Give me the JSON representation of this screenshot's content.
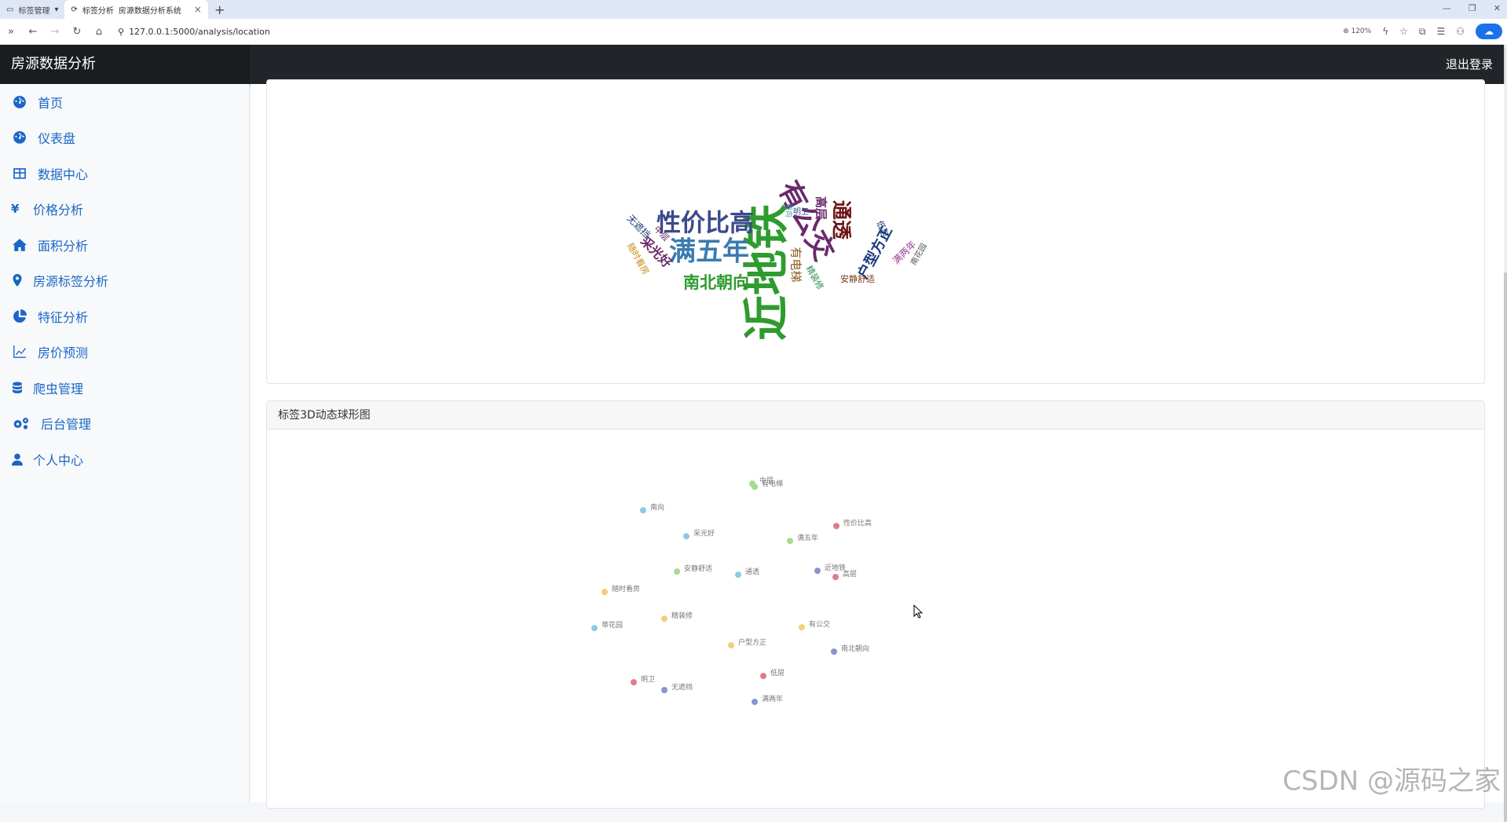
{
  "browser": {
    "tabs": [
      {
        "label": "标签管理",
        "kind": "group"
      },
      {
        "label": "标签分析",
        "kind": "normal"
      },
      {
        "label": "房源数据分析系统",
        "kind": "active"
      }
    ],
    "url": "127.0.0.1:5000/analysis/location",
    "zoom": "120%"
  },
  "header": {
    "brand": "房源数据分析",
    "logout": "退出登录"
  },
  "sidebar": {
    "items": [
      {
        "label": "首页",
        "icon": "dashboard-icon"
      },
      {
        "label": "仪表盘",
        "icon": "dashboard-icon"
      },
      {
        "label": "数据中心",
        "icon": "table-icon"
      },
      {
        "label": "价格分析",
        "icon": "yen-icon"
      },
      {
        "label": "面积分析",
        "icon": "home-icon"
      },
      {
        "label": "房源标签分析",
        "icon": "map-marker-icon"
      },
      {
        "label": "特征分析",
        "icon": "pie-chart-icon"
      },
      {
        "label": "房价预测",
        "icon": "line-chart-icon"
      },
      {
        "label": "爬虫管理",
        "icon": "database-icon"
      },
      {
        "label": "后台管理",
        "icon": "cogs-icon"
      },
      {
        "label": "个人中心",
        "icon": "user-icon"
      }
    ]
  },
  "sphere_card": {
    "title": "标签3D动态球形图"
  },
  "wordcloud": {
    "words": [
      {
        "text": "近地铁",
        "color": "#2e9b2e"
      },
      {
        "text": "满五年",
        "color": "#3a7bb0"
      },
      {
        "text": "性价比高",
        "color": "#3a4a8a"
      },
      {
        "text": "有公交",
        "color": "#6a2a6a"
      },
      {
        "text": "南北朝向",
        "color": "#2e9b2e"
      },
      {
        "text": "通透",
        "color": "#6b1515"
      },
      {
        "text": "户型方正",
        "color": "#1a3a7a"
      },
      {
        "text": "采光好",
        "color": "#6a2a6a"
      },
      {
        "text": "有电梯",
        "color": "#8a5a1a"
      },
      {
        "text": "高层",
        "color": "#6a2a6a"
      },
      {
        "text": "无遮挡",
        "color": "#1a3a7a"
      },
      {
        "text": "中层",
        "color": "#6a2a6a"
      },
      {
        "text": "随时看房",
        "color": "#c98a1a"
      },
      {
        "text": "精装修",
        "color": "#2e8a5a"
      },
      {
        "text": "安静舒适",
        "color": "#7a3a1a"
      },
      {
        "text": "满两年",
        "color": "#9a3a9a"
      },
      {
        "text": "南花园",
        "color": "#555555"
      },
      {
        "text": "低层",
        "color": "#1a3a7a"
      },
      {
        "text": "明卫",
        "color": "#2e5a8a"
      },
      {
        "text": "南向",
        "color": "#2e9b9b"
      }
    ]
  },
  "sphere": {
    "labels": [
      {
        "text": "中层",
        "color": "#a8d98f"
      },
      {
        "text": "有电梯",
        "color": "#a8d98f"
      },
      {
        "text": "南向",
        "color": "#8fc9e6"
      },
      {
        "text": "性价比高",
        "color": "#e07b8a"
      },
      {
        "text": "采光好",
        "color": "#8fc9e6"
      },
      {
        "text": "满五年",
        "color": "#a8d98f"
      },
      {
        "text": "安静舒适",
        "color": "#a8d98f"
      },
      {
        "text": "通透",
        "color": "#8fc9e6"
      },
      {
        "text": "近地铁",
        "color": "#8a93d0"
      },
      {
        "text": "高层",
        "color": "#e07b8a"
      },
      {
        "text": "随时看房",
        "color": "#f3cf7a"
      },
      {
        "text": "精装修",
        "color": "#f3cf7a"
      },
      {
        "text": "带花园",
        "color": "#8fc9e6"
      },
      {
        "text": "有公交",
        "color": "#f3cf7a"
      },
      {
        "text": "户型方正",
        "color": "#f3cf7a"
      },
      {
        "text": "南北朝向",
        "color": "#8a93d0"
      },
      {
        "text": "低层",
        "color": "#e07b8a"
      },
      {
        "text": "明卫",
        "color": "#e07b8a"
      },
      {
        "text": "无遮挡",
        "color": "#8a93d0"
      },
      {
        "text": "满两年",
        "color": "#8a93d0"
      }
    ]
  },
  "watermark": "CSDN @源码之家"
}
